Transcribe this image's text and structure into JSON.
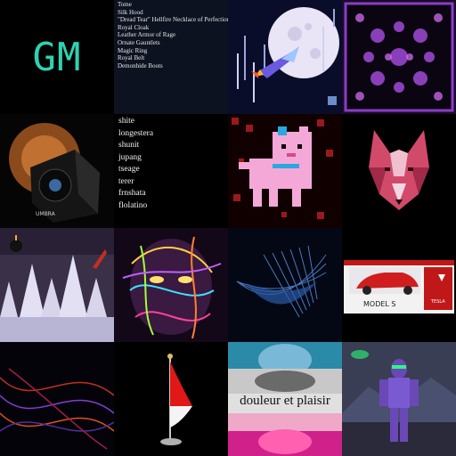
{
  "gm_tile": {
    "text": "GM",
    "color": "#2fd2b0"
  },
  "item_list": {
    "items": [
      "Tome",
      "Silk Hood",
      "\"Dread Tear\" Hellfire Necklace of Perfection",
      "Royal Cloak",
      "Leather Armor of Rage",
      "Ornate Gauntlets",
      "Magic Ring",
      "Royal Belt",
      "Demonhide Boots"
    ]
  },
  "word_list": {
    "items": [
      "shite",
      "longestera",
      "shunit",
      "jupang",
      "tseage",
      "terer",
      "frnshata",
      "flolatino"
    ]
  },
  "speaker_box": {
    "label": "UMBRA"
  },
  "tesla_box": {
    "model": "MODEL S",
    "brand": "TESLA"
  },
  "collage": {
    "caption": "douleur et plaisir"
  },
  "icons": [
    "bomb-icon",
    "rocket-icon",
    "moon-icon",
    "wolf-icon",
    "dog-icon",
    "flag-icon"
  ],
  "colors": {
    "gm": "#2fd2b0",
    "list_bg": "#0c1220",
    "purple": "#8a3cc8"
  }
}
